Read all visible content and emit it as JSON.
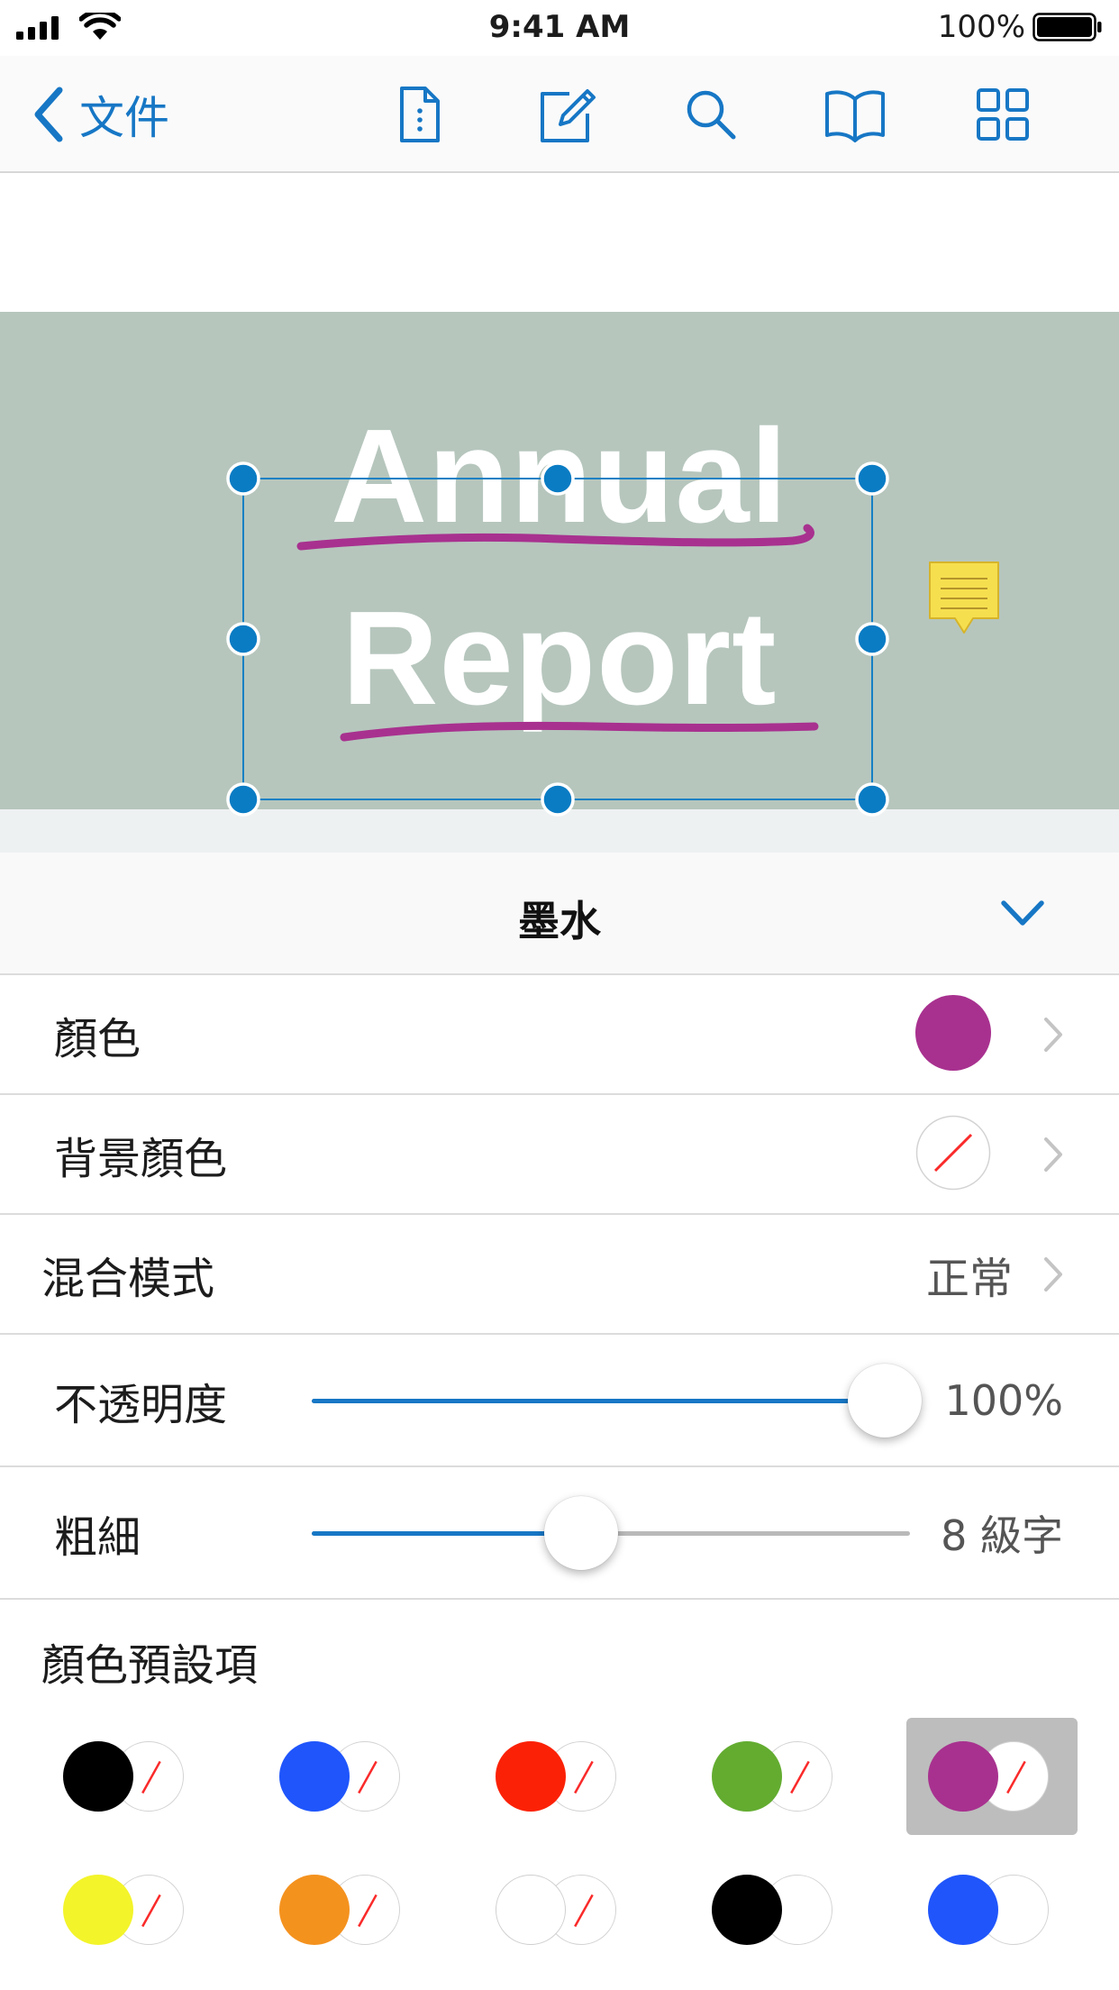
{
  "status_bar": {
    "time": "9:41 AM",
    "battery": "100%"
  },
  "nav": {
    "back_label": "文件",
    "icons": [
      "document-outline-icon",
      "edit-pencil-icon",
      "search-icon",
      "reading-book-icon",
      "thumbnails-grid-icon"
    ]
  },
  "document": {
    "title_line1": "Annual",
    "title_line2": "Report",
    "banner_color": "#b6c6bd",
    "ink_color": "#a8318f",
    "selection_color": "#1580c4"
  },
  "panel": {
    "title": "墨水",
    "color_label": "顏色",
    "color_value": "#a8318f",
    "background_color_label": "背景顏色",
    "background_color_value": "none",
    "blend_mode_label": "混合模式",
    "blend_mode_value": "正常",
    "opacity_label": "不透明度",
    "opacity_value": "100%",
    "opacity_fraction": 1.0,
    "thickness_label": "粗細",
    "thickness_value": "8 級字",
    "thickness_fraction": 0.45,
    "presets_label": "顏色預設項",
    "presets": [
      {
        "color": "#000000",
        "background": "none",
        "selected": false
      },
      {
        "color": "#1f55fb",
        "background": "none",
        "selected": false
      },
      {
        "color": "#fb2106",
        "background": "none",
        "selected": false
      },
      {
        "color": "#63ac30",
        "background": "none",
        "selected": false
      },
      {
        "color": "#a8318f",
        "background": "none",
        "selected": true
      },
      {
        "color": "#f3f42a",
        "background": "none",
        "selected": false
      },
      {
        "color": "#f4921e",
        "background": "none",
        "selected": false
      },
      {
        "color": "#ffffff",
        "background": "none",
        "selected": false
      },
      {
        "color": "#000000",
        "background": "#ffffff",
        "selected": false
      },
      {
        "color": "#1f55fb",
        "background": "#ffffff",
        "selected": false
      }
    ]
  }
}
